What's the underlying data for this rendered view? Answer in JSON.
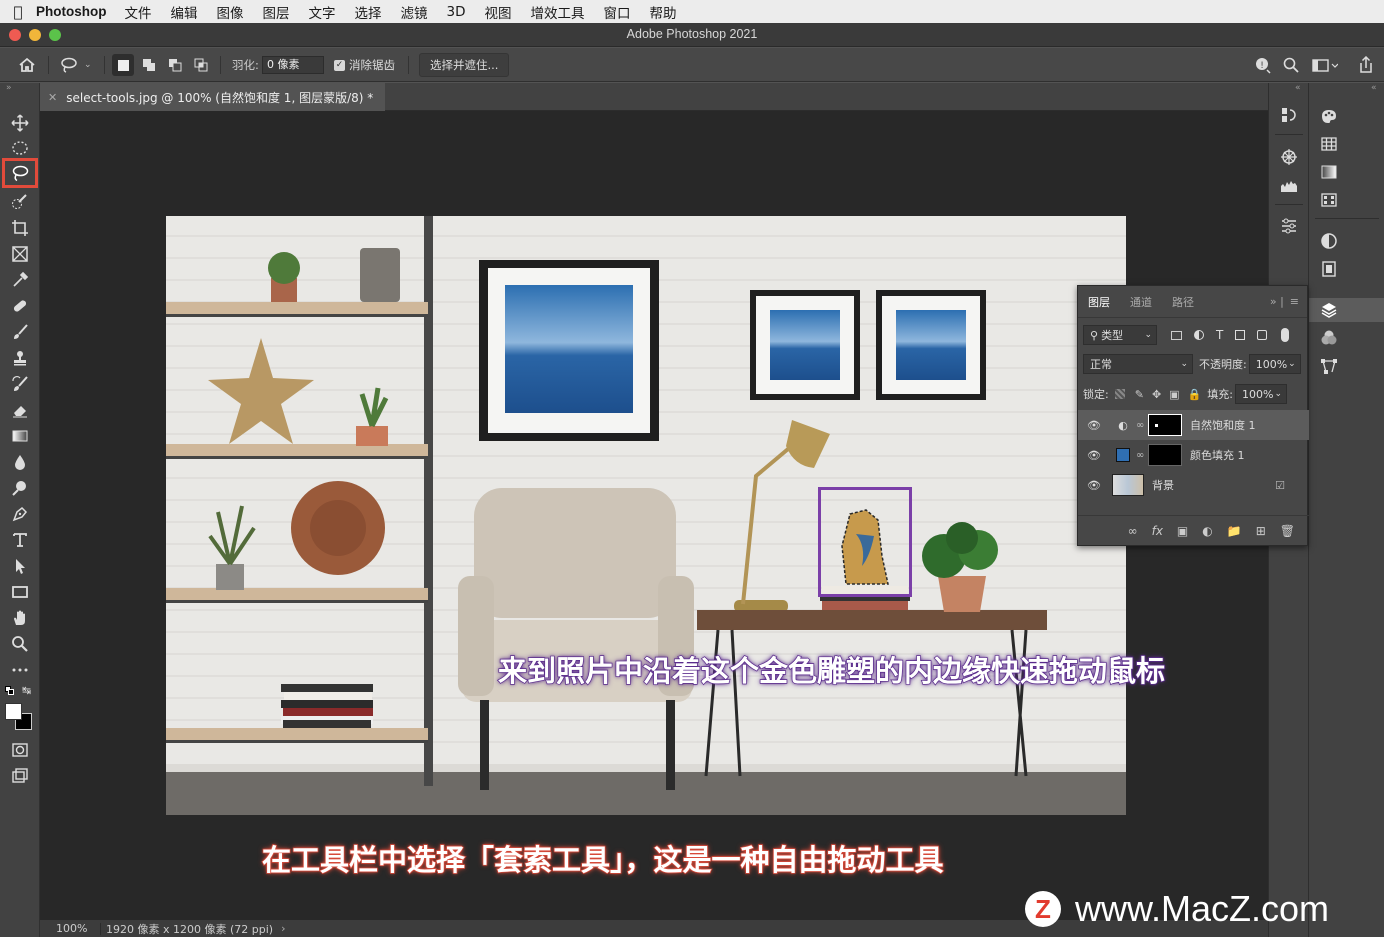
{
  "menubar": {
    "app_name": "Photoshop",
    "items": [
      "文件",
      "编辑",
      "图像",
      "图层",
      "文字",
      "选择",
      "滤镜",
      "3D",
      "视图",
      "增效工具",
      "窗口",
      "帮助"
    ]
  },
  "window": {
    "title": "Adobe Photoshop 2021"
  },
  "options_bar": {
    "feather_label": "羽化:",
    "feather_value": "0 像素",
    "antialias_label": "消除锯齿",
    "select_mask_label": "选择并遮住..."
  },
  "document": {
    "tab_title": "select-tools.jpg @ 100% (自然饱和度 1, 图层蒙版/8) *"
  },
  "status": {
    "zoom": "100%",
    "info": "1920 像素 x 1200 像素 (72 ppi)"
  },
  "layers_panel": {
    "tabs": [
      "图层",
      "通道",
      "路径"
    ],
    "filter_label": "类型",
    "blend_mode": "正常",
    "opacity_label": "不透明度:",
    "opacity_value": "100%",
    "lock_label": "锁定:",
    "fill_label": "填充:",
    "fill_value": "100%",
    "layers": [
      {
        "name": "自然饱和度 1",
        "selected": true
      },
      {
        "name": "颜色填充 1",
        "selected": false
      },
      {
        "name": "背景",
        "selected": false
      }
    ]
  },
  "captions": {
    "top": "来到照片中沿着这个金色雕塑的内边缘快速拖动鼠标",
    "bottom": "在工具栏中选择「套索工具」，这是一种自由拖动工具"
  },
  "watermark": {
    "logo_letter": "Z",
    "text": "www.MacZ.com"
  },
  "colors": {
    "highlight_red": "#e24b3b",
    "selection_purple": "#7b3fa8",
    "canvas_bg": "#282828"
  }
}
